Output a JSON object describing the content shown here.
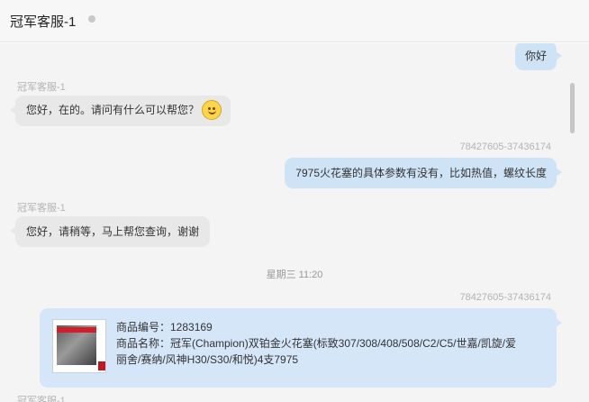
{
  "header": {
    "title": "冠军客服-1",
    "status": "offline"
  },
  "messages": [
    {
      "side": "right",
      "sender": "",
      "text": "你好"
    },
    {
      "side": "left",
      "sender": "冠军客服-1",
      "text": "您好，在的。请问有什么可以帮您？",
      "emoji": "smile-emoji"
    },
    {
      "side": "right",
      "sender": "78427605-37436174",
      "text": "7975火花塞的具体参数有没有，比如热值，螺纹长度"
    },
    {
      "side": "left",
      "sender": "冠军客服-1",
      "text": "您好，请稍等，马上帮您查询，谢谢"
    }
  ],
  "time_divider": "星期三 11:20",
  "product_message": {
    "sender": "78427605-37436174",
    "line1": "商品编号：1283169",
    "line2": "商品名称：冠军(Champion)双铂金火花塞(标致307/308/408/508/C2/C5/世嘉/凯旋/爱",
    "line3": "丽舍/赛纳/风神H30/S30/和悦)4支7975"
  },
  "colors": {
    "left_bubble": "#e8e8e8",
    "right_bubble": "#cfe3f7",
    "chat_bg": "#f4f4f4"
  }
}
